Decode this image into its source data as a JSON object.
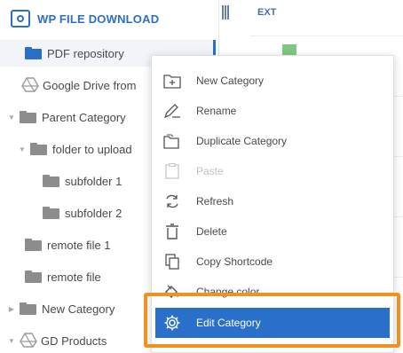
{
  "sidebar": {
    "brand": "WP FILE DOWNLOAD",
    "items": [
      {
        "label": "PDF repository"
      },
      {
        "label": "Google Drive from"
      },
      {
        "label": "Parent Category"
      },
      {
        "label": "folder to upload"
      },
      {
        "label": "subfolder 1"
      },
      {
        "label": "subfolder 2"
      },
      {
        "label": "remote file 1"
      },
      {
        "label": "remote file"
      },
      {
        "label": "New Category"
      },
      {
        "label": "GD Products"
      }
    ]
  },
  "main": {
    "column_header": "EXT"
  },
  "context_menu": {
    "items": [
      {
        "label": "New Category",
        "icon": "new-category-icon",
        "disabled": false
      },
      {
        "label": "Rename",
        "icon": "rename-icon",
        "disabled": false
      },
      {
        "label": "Duplicate Category",
        "icon": "duplicate-icon",
        "disabled": false
      },
      {
        "label": "Paste",
        "icon": "paste-icon",
        "disabled": true
      },
      {
        "label": "Refresh",
        "icon": "refresh-icon",
        "disabled": false
      },
      {
        "label": "Delete",
        "icon": "delete-icon",
        "disabled": false
      },
      {
        "label": "Copy Shortcode",
        "icon": "copy-icon",
        "disabled": false
      },
      {
        "label": "Change color",
        "icon": "paint-bucket-icon",
        "disabled": false
      },
      {
        "label": "Edit Category",
        "icon": "gear-icon",
        "disabled": false,
        "selected": true
      }
    ]
  },
  "colors": {
    "accent": "#2a6fc9",
    "highlight": "#f0921f"
  }
}
